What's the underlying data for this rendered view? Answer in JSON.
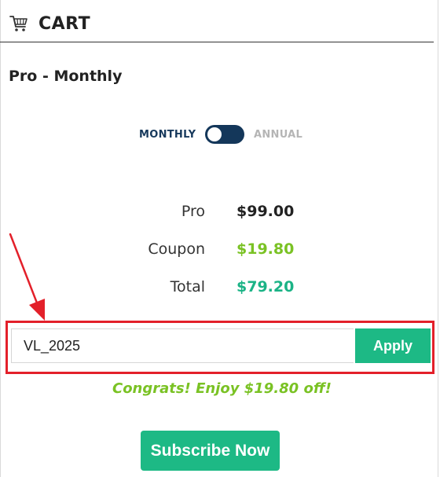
{
  "header": {
    "icon": "cart-icon",
    "title": "CART"
  },
  "plan": {
    "name": "Pro - Monthly"
  },
  "billing": {
    "monthly_label": "MONTHLY",
    "annual_label": "ANNUAL",
    "selected": "MONTHLY"
  },
  "summary": {
    "rows": [
      {
        "label": "Pro",
        "value": "$99.00"
      },
      {
        "label": "Coupon",
        "value": "$19.80"
      },
      {
        "label": "Total",
        "value": "$79.20"
      }
    ]
  },
  "coupon": {
    "code": "VL_2025",
    "apply_label": "Apply",
    "message": "Congrats! Enjoy $19.80 off!"
  },
  "actions": {
    "subscribe_label": "Subscribe Now"
  },
  "colors": {
    "brand_navy": "#14375a",
    "accent_green": "#1db985",
    "discount_lime": "#7ac224",
    "annotation_red": "#e3202a"
  }
}
